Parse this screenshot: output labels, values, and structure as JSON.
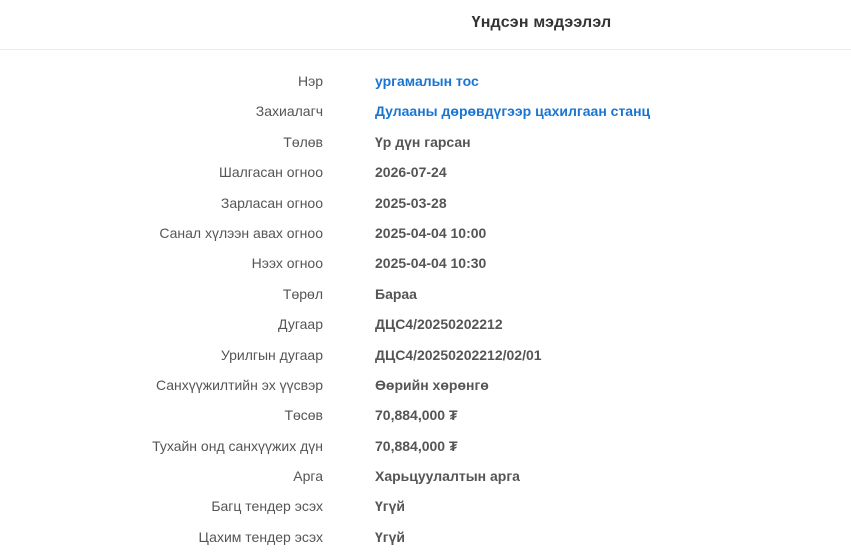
{
  "header": {
    "title": "Үндсэн мэдээлэл"
  },
  "colors": {
    "link": "#1a75d2",
    "text": "#555555",
    "title": "#333333"
  },
  "rows": [
    {
      "label": "Нэр",
      "value": "ургамалын тос",
      "link": true
    },
    {
      "label": "Захиалагч",
      "value": "Дулааны дөрөвдүгээр цахилгаан станц",
      "link": true
    },
    {
      "label": "Төлөв",
      "value": "Үр дүн гарсан",
      "link": false
    },
    {
      "label": "Шалгасан огноо",
      "value": "2026-07-24",
      "link": false
    },
    {
      "label": "Зарласан огноо",
      "value": "2025-03-28",
      "link": false
    },
    {
      "label": "Санал хүлээн авах огноо",
      "value": "2025-04-04 10:00",
      "link": false
    },
    {
      "label": "Нээх огноо",
      "value": "2025-04-04 10:30",
      "link": false
    },
    {
      "label": "Төрөл",
      "value": "Бараа",
      "link": false
    },
    {
      "label": "Дугаар",
      "value": "ДЦС4/20250202212",
      "link": false
    },
    {
      "label": "Урилгын дугаар",
      "value": "ДЦС4/20250202212/02/01",
      "link": false
    },
    {
      "label": "Санхүүжилтийн эх үүсвэр",
      "value": "Өөрийн хөрөнгө",
      "link": false
    },
    {
      "label": "Төсөв",
      "value": "70,884,000 ₮",
      "link": false
    },
    {
      "label": "Тухайн онд санхүүжих дүн",
      "value": "70,884,000 ₮",
      "link": false
    },
    {
      "label": "Арга",
      "value": "Харьцуулалтын арга",
      "link": false
    },
    {
      "label": "Багц тендер эсэх",
      "value": "Үгүй",
      "link": false
    },
    {
      "label": "Цахим тендер эсэх",
      "value": "Үгүй",
      "link": false
    }
  ]
}
